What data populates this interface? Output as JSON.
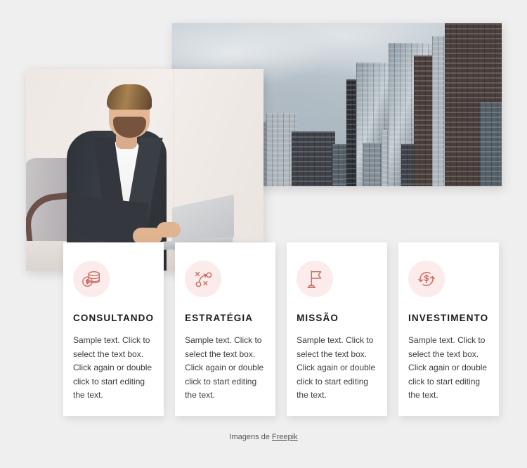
{
  "page": {
    "background_color": "#f0efef"
  },
  "media": {
    "city_photo": {
      "alt": "city skyline with glass skyscrapers under a cloudy sky",
      "name": "city-skyline-photo"
    },
    "man_photo": {
      "alt": "bearded businessman in dark blazer working on a laptop",
      "name": "businessman-laptop-photo"
    }
  },
  "cards": [
    {
      "icon": "coins-stack-icon",
      "title": "CONSULTANDO",
      "text": "Sample text. Click to select the text box. Click again or double click to start editing the text."
    },
    {
      "icon": "strategy-playbook-icon",
      "title": "ESTRATÉGIA",
      "text": "Sample text. Click to select the text box. Click again or double click to start editing the text."
    },
    {
      "icon": "flag-icon",
      "title": "MISSÃO",
      "text": "Sample text. Click to select the text box. Click again or double click to start editing the text."
    },
    {
      "icon": "money-cycle-icon",
      "title": "INVESTIMENTO",
      "text": "Sample text. Click to select the text box. Click again or double click to start editing the text."
    }
  ],
  "footer": {
    "prefix": "Imagens de ",
    "link_label": "Freepik"
  },
  "colors": {
    "accent": "#c9695e",
    "icon_circle": "#fbeceb",
    "card_background": "#ffffff",
    "heading": "#1b1b1b",
    "body_text": "#3d3d3d"
  }
}
